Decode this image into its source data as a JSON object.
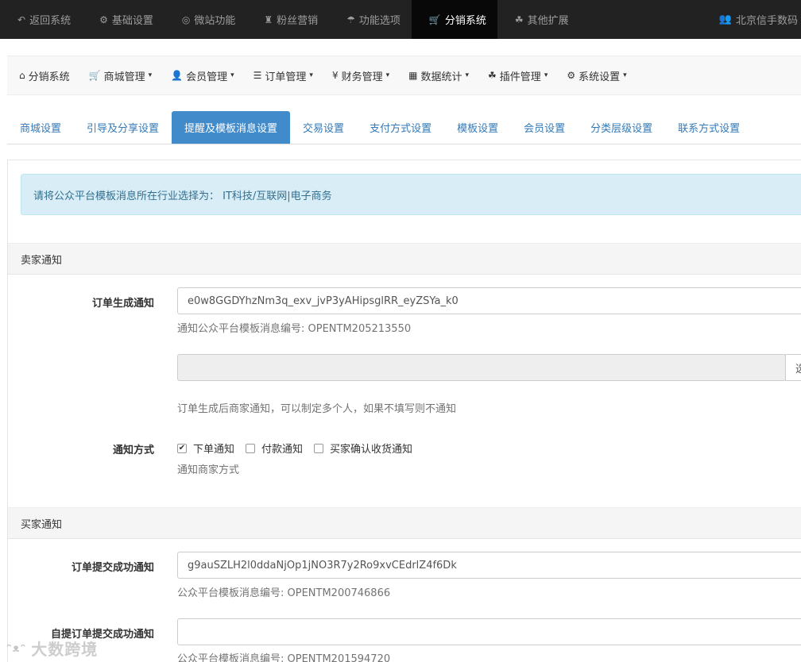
{
  "topnav": {
    "items": [
      {
        "icon": "↶",
        "icon_name": "back-icon",
        "label": "返回系统"
      },
      {
        "icon": "⚙",
        "icon_name": "gear-icon",
        "label": "基础设置"
      },
      {
        "icon": "◎",
        "icon_name": "lifebuoy-icon",
        "label": "微站功能"
      },
      {
        "icon": "♜",
        "icon_name": "gift-icon",
        "label": "粉丝营销"
      },
      {
        "icon": "☂",
        "icon_name": "umbrella-icon",
        "label": "功能选项"
      },
      {
        "icon": "🛒",
        "icon_name": "cart-icon",
        "label": "分销系统"
      },
      {
        "icon": "☘",
        "icon_name": "cubes-icon",
        "label": "其他扩展"
      }
    ],
    "user": {
      "icon": "👥",
      "label": "北京信手数码"
    }
  },
  "mainnav": {
    "items": [
      {
        "icon": "⌂",
        "icon_name": "home-icon",
        "label": "分销系统",
        "caret": ""
      },
      {
        "icon": "🛒",
        "icon_name": "cart-icon",
        "label": "商城管理",
        "caret": "▾"
      },
      {
        "icon": "👤",
        "icon_name": "user-icon",
        "label": "会员管理",
        "caret": "▾"
      },
      {
        "icon": "☰",
        "icon_name": "file-icon",
        "label": "订单管理",
        "caret": "▾"
      },
      {
        "icon": "¥",
        "icon_name": "money-icon",
        "label": "财务管理",
        "caret": "▾"
      },
      {
        "icon": "▦",
        "icon_name": "bar-chart-icon",
        "label": "数据统计",
        "caret": "▾"
      },
      {
        "icon": "☘",
        "icon_name": "cubes-icon",
        "label": "插件管理",
        "caret": "▾"
      },
      {
        "icon": "⚙",
        "icon_name": "gear-icon",
        "label": "系统设置",
        "caret": "▾"
      }
    ]
  },
  "tabs": [
    {
      "label": "商城设置"
    },
    {
      "label": "引导及分享设置"
    },
    {
      "label": "提醒及模板消息设置"
    },
    {
      "label": "交易设置"
    },
    {
      "label": "支付方式设置"
    },
    {
      "label": "模板设置"
    },
    {
      "label": "会员设置"
    },
    {
      "label": "分类层级设置"
    },
    {
      "label": "联系方式设置"
    }
  ],
  "alert": "请将公众平台模板消息所在行业选择为： IT科技/互联网|电子商务",
  "seller": {
    "heading": "卖家通知",
    "order_created": {
      "label": "订单生成通知",
      "value": "e0w8GGDYhzNm3q_exv_jvP3yAHipsglRR_eyZSYa_k0",
      "help": "通知公众平台模板消息编号: OPENTM205213550"
    },
    "merchant_select": {
      "value": "",
      "addon": "选",
      "help": "订单生成后商家通知，可以制定多个人，如果不填写则不通知"
    },
    "notify_method": {
      "label": "通知方式",
      "options": [
        {
          "label": "下单通知",
          "checked": "✔"
        },
        {
          "label": "付款通知",
          "checked": ""
        },
        {
          "label": "买家确认收货通知",
          "checked": ""
        }
      ],
      "help": "通知商家方式"
    }
  },
  "buyer": {
    "heading": "买家通知",
    "order_submitted": {
      "label": "订单提交成功通知",
      "value": "g9auSZLH2l0ddaNjOp1jNO3R7y2Ro9xvCEdrlZ4f6Dk",
      "help": "公众平台模板消息编号: OPENTM200746866"
    },
    "pickup_submitted": {
      "label": "自提订单提交成功通知",
      "value": "",
      "help": "公众平台模板消息编号: OPENTM201594720"
    }
  },
  "watermark": "大数跨境"
}
